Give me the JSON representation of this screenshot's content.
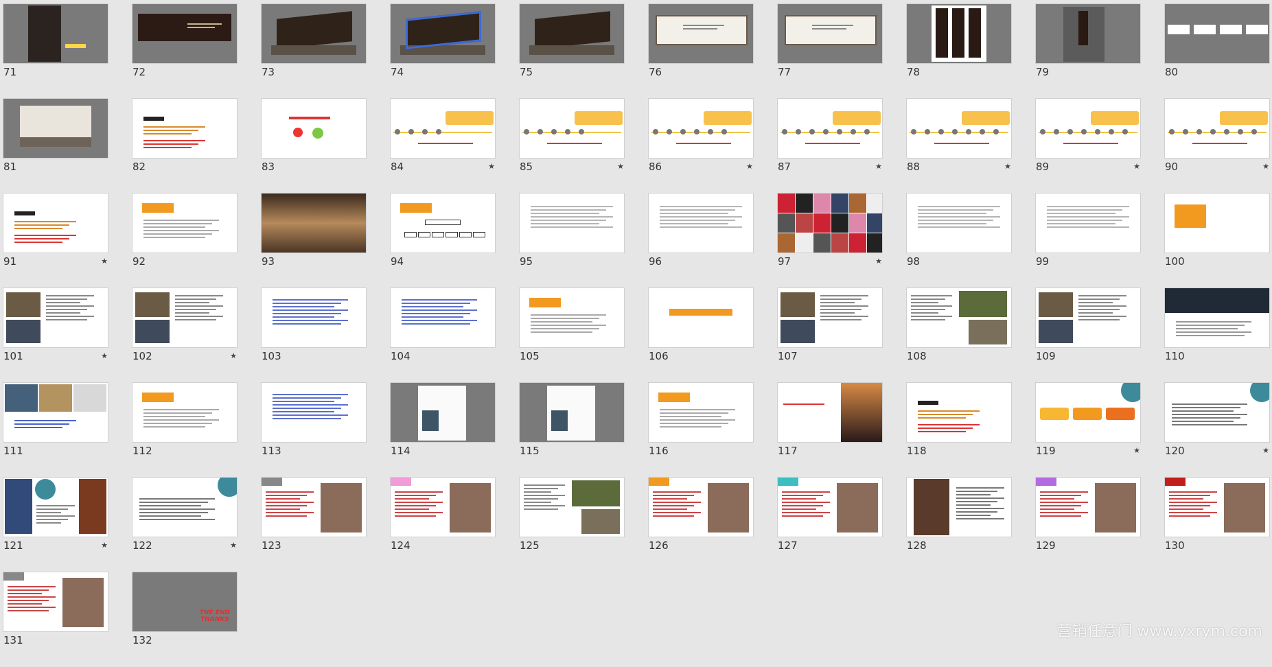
{
  "slides": [
    {
      "n": "71",
      "s": false,
      "t": "gray-photo"
    },
    {
      "n": "72",
      "s": false,
      "t": "gray-board"
    },
    {
      "n": "73",
      "s": false,
      "t": "gray-bill"
    },
    {
      "n": "74",
      "s": false,
      "t": "gray-bill2"
    },
    {
      "n": "75",
      "s": false,
      "t": "gray-bill"
    },
    {
      "n": "76",
      "s": false,
      "t": "gray-white"
    },
    {
      "n": "77",
      "s": false,
      "t": "gray-white"
    },
    {
      "n": "78",
      "s": false,
      "t": "gray-banners"
    },
    {
      "n": "79",
      "s": false,
      "t": "gray-pole"
    },
    {
      "n": "80",
      "s": false,
      "t": "gray-strip"
    },
    {
      "n": "81",
      "s": false,
      "t": "gray-wall"
    },
    {
      "n": "82",
      "s": false,
      "t": "text-red"
    },
    {
      "n": "83",
      "s": false,
      "t": "text-icons"
    },
    {
      "n": "84",
      "s": true,
      "t": "timeline"
    },
    {
      "n": "85",
      "s": true,
      "t": "timeline"
    },
    {
      "n": "86",
      "s": true,
      "t": "timeline"
    },
    {
      "n": "87",
      "s": true,
      "t": "timeline"
    },
    {
      "n": "88",
      "s": true,
      "t": "timeline"
    },
    {
      "n": "89",
      "s": true,
      "t": "timeline"
    },
    {
      "n": "90",
      "s": true,
      "t": "timeline"
    },
    {
      "n": "91",
      "s": true,
      "t": "text-red"
    },
    {
      "n": "92",
      "s": false,
      "t": "orange-head"
    },
    {
      "n": "93",
      "s": false,
      "t": "photo-room"
    },
    {
      "n": "94",
      "s": false,
      "t": "orange-chart"
    },
    {
      "n": "95",
      "s": false,
      "t": "text"
    },
    {
      "n": "96",
      "s": false,
      "t": "text"
    },
    {
      "n": "97",
      "s": true,
      "t": "collage"
    },
    {
      "n": "98",
      "s": false,
      "t": "text"
    },
    {
      "n": "99",
      "s": false,
      "t": "text"
    },
    {
      "n": "100",
      "s": false,
      "t": "orange-big"
    },
    {
      "n": "101",
      "s": true,
      "t": "photos-left"
    },
    {
      "n": "102",
      "s": true,
      "t": "photos-left"
    },
    {
      "n": "103",
      "s": false,
      "t": "text-blue"
    },
    {
      "n": "104",
      "s": false,
      "t": "text-blue"
    },
    {
      "n": "105",
      "s": false,
      "t": "orange-head"
    },
    {
      "n": "106",
      "s": false,
      "t": "orange-bar"
    },
    {
      "n": "107",
      "s": false,
      "t": "photos-left"
    },
    {
      "n": "108",
      "s": false,
      "t": "photos-right"
    },
    {
      "n": "109",
      "s": false,
      "t": "photos-left"
    },
    {
      "n": "110",
      "s": false,
      "t": "photo-top"
    },
    {
      "n": "111",
      "s": false,
      "t": "photos-top"
    },
    {
      "n": "112",
      "s": false,
      "t": "orange-head"
    },
    {
      "n": "113",
      "s": false,
      "t": "text-blue"
    },
    {
      "n": "114",
      "s": false,
      "t": "gray-doc"
    },
    {
      "n": "115",
      "s": false,
      "t": "gray-doc"
    },
    {
      "n": "116",
      "s": false,
      "t": "orange-head"
    },
    {
      "n": "117",
      "s": false,
      "t": "photo-right"
    },
    {
      "n": "118",
      "s": false,
      "t": "text-red"
    },
    {
      "n": "119",
      "s": true,
      "t": "circle-boxes"
    },
    {
      "n": "120",
      "s": true,
      "t": "circle"
    },
    {
      "n": "121",
      "s": true,
      "t": "photos-circle"
    },
    {
      "n": "122",
      "s": true,
      "t": "circle"
    },
    {
      "n": "123",
      "s": false,
      "t": "tag-gray"
    },
    {
      "n": "124",
      "s": false,
      "t": "tag-pink"
    },
    {
      "n": "125",
      "s": false,
      "t": "photos-right"
    },
    {
      "n": "126",
      "s": false,
      "t": "tag-orange"
    },
    {
      "n": "127",
      "s": false,
      "t": "tag-teal"
    },
    {
      "n": "128",
      "s": false,
      "t": "photo-left"
    },
    {
      "n": "129",
      "s": false,
      "t": "tag-purple"
    },
    {
      "n": "130",
      "s": false,
      "t": "tag-red"
    },
    {
      "n": "131",
      "s": false,
      "t": "tag-gray2"
    },
    {
      "n": "132",
      "s": false,
      "t": "gray-end"
    }
  ],
  "watermark": "营销任意门 www.yxrym.com",
  "end_text": [
    "THE END",
    "THANKS"
  ],
  "star_glyph": "★"
}
